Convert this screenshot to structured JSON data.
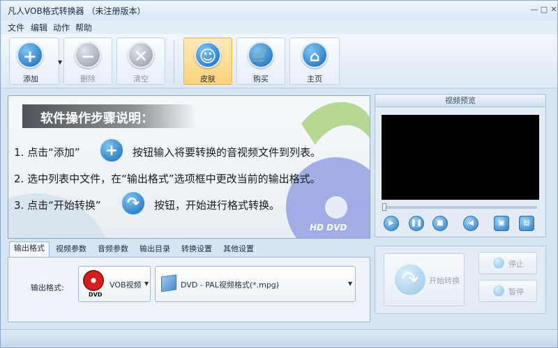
{
  "window": {
    "title": "凡人VOB格式转换器  （未注册版本）"
  },
  "menu": [
    "文件",
    "编辑",
    "动作",
    "帮助"
  ],
  "toolbar": {
    "add": "添加",
    "delete": "删除",
    "clear": "清空",
    "skin": "皮肤",
    "buy": "购买",
    "home": "主页"
  },
  "guide": {
    "heading": "软件操作步骤说明：",
    "step1_prefix": "1. 点击“添加”",
    "step1_suffix": "按钮输入将要转换的音视频文件到列表。",
    "step2": "2. 选中列表中文件，在“输出格式”选项框中更改当前的输出格式。",
    "step3_prefix": "3. 点击“开始转换”",
    "step3_suffix": "按钮，开始进行格式转换。",
    "disc_badge": "HD DVD"
  },
  "preview": {
    "title": "视频预览"
  },
  "tabs": [
    "输出格式",
    "视频参数",
    "音频参数",
    "输出目录",
    "转换设置",
    "其他设置"
  ],
  "output": {
    "label": "输出格式:",
    "category": "VOB视频",
    "category_icon_text": "DVD",
    "format": "DVD - PAL视频格式(*.mpg)"
  },
  "actions": {
    "start": "开始转换",
    "stop": "停止",
    "pause": "暂停"
  },
  "colors": {
    "accent": "#1669b8",
    "active_button": "#fbd27c",
    "panel": "#e3ecf6"
  }
}
